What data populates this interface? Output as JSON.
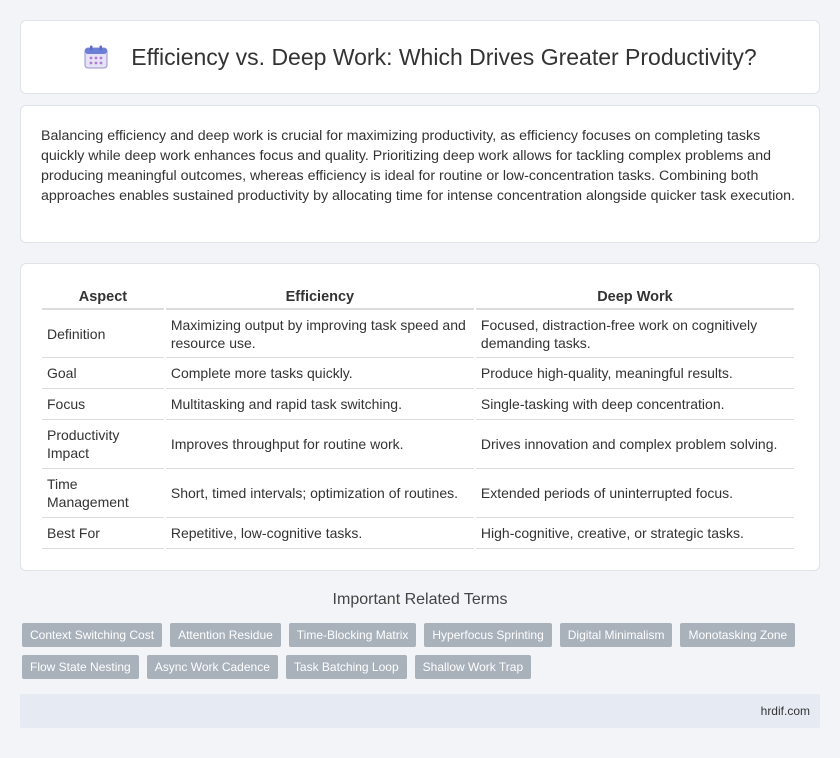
{
  "page": {
    "title": "Efficiency vs. Deep Work: Which Drives Greater Productivity?",
    "title_icon": "calendar-icon"
  },
  "summary": "Balancing efficiency and deep work is crucial for maximizing productivity, as efficiency focuses on completing tasks quickly while deep work enhances focus and quality. Prioritizing deep work allows for tackling complex problems and producing meaningful outcomes, whereas efficiency is ideal for routine or low-concentration tasks. Combining both approaches enables sustained productivity by allocating time for intense concentration alongside quicker task execution.",
  "table": {
    "headers": [
      "Aspect",
      "Efficiency",
      "Deep Work"
    ],
    "rows": [
      [
        "Definition",
        "Maximizing output by improving task speed and resource use.",
        "Focused, distraction-free work on cognitively demanding tasks."
      ],
      [
        "Goal",
        "Complete more tasks quickly.",
        "Produce high-quality, meaningful results."
      ],
      [
        "Focus",
        "Multitasking and rapid task switching.",
        "Single-tasking with deep concentration."
      ],
      [
        "Productivity Impact",
        "Improves throughput for routine work.",
        "Drives innovation and complex problem solving."
      ],
      [
        "Time Management",
        "Short, timed intervals; optimization of routines.",
        "Extended periods of uninterrupted focus."
      ],
      [
        "Best For",
        "Repetitive, low-cognitive tasks.",
        "High-cognitive, creative, or strategic tasks."
      ]
    ]
  },
  "related": {
    "title": "Important Related Terms",
    "tags": [
      "Context Switching Cost",
      "Attention Residue",
      "Time-Blocking Matrix",
      "Hyperfocus Sprinting",
      "Digital Minimalism",
      "Monotasking Zone",
      "Flow State Nesting",
      "Async Work Cadence",
      "Task Batching Loop",
      "Shallow Work Trap"
    ]
  },
  "footer": {
    "site": "hrdif.com"
  },
  "colors": {
    "tag_bg": "#a9b1bb",
    "footer_bg": "#e6ebf3",
    "page_bg": "#f2f4f7"
  }
}
